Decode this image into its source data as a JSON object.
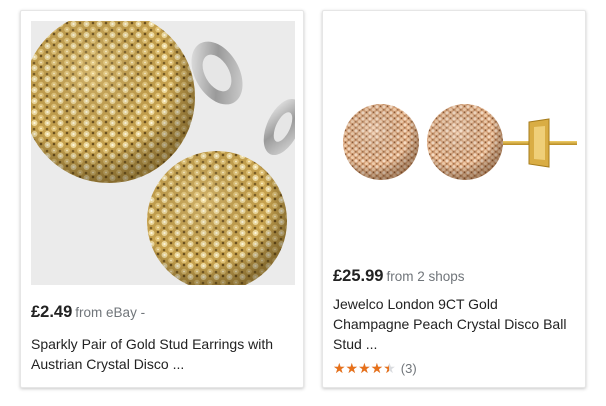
{
  "products": [
    {
      "price": "£2.49",
      "source": "from eBay -",
      "title": "Sparkly Pair of Gold Stud Earrings with Austrian Crystal Disco ...",
      "image": "gold-crystal-disco-ball-stud-earrings-closeup"
    },
    {
      "price": "£25.99",
      "source": "from 2 shops",
      "title": "Jewelco London 9CT Gold Champagne Peach Crystal Disco Ball Stud ...",
      "image": "champagne-crystal-ball-stud-earrings",
      "rating": {
        "value": 4.5,
        "max": 5,
        "stars_text": "★★★★★",
        "count": "(3)"
      }
    }
  ],
  "colors": {
    "star": "#e7711b",
    "text": "#222222",
    "secondary_text": "#70757a"
  }
}
